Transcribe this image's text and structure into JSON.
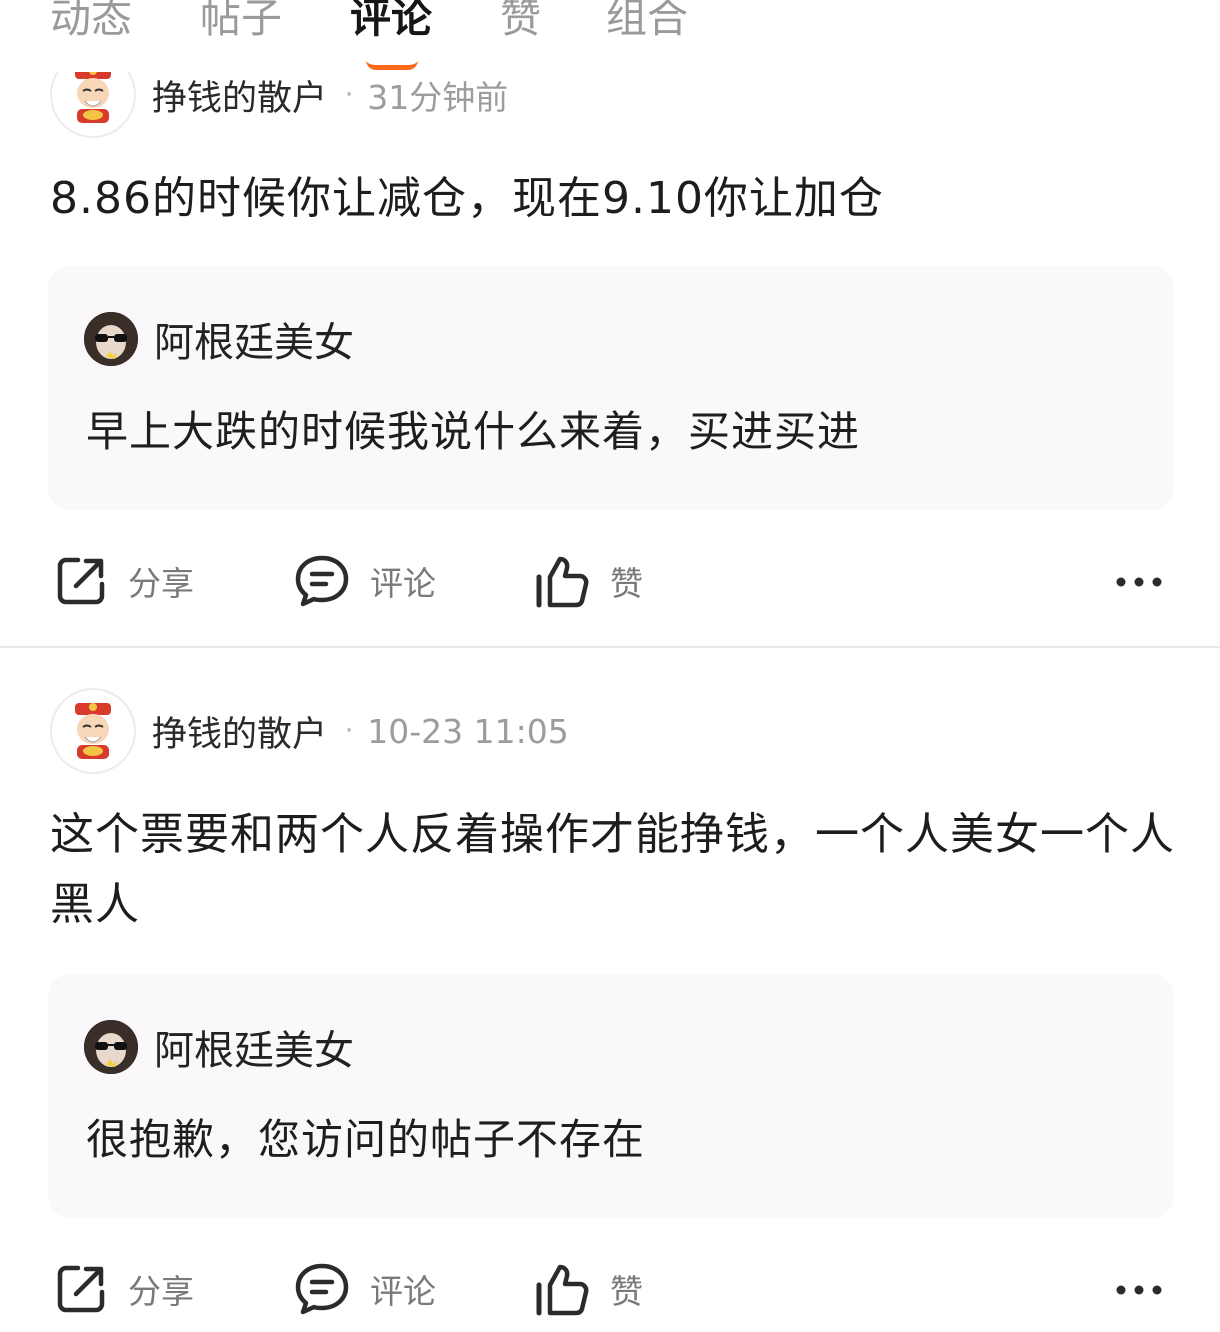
{
  "tabs": [
    {
      "label": "动态"
    },
    {
      "label": "帖子"
    },
    {
      "label": "评论"
    },
    {
      "label": "赞"
    },
    {
      "label": "组合"
    }
  ],
  "active_tab_index": 2,
  "colors": {
    "accent": "#ff6a1a",
    "quote_bg": "#fbf8fb",
    "muted_text": "#9c9c9c"
  },
  "comments": [
    {
      "author": "挣钱的散户",
      "time": "31分钟前",
      "text": "8.86的时候你让减仓，现在9.10你让加仓",
      "quote": {
        "author": "阿根廷美女",
        "text": "早上大跌的时候我说什么来着，买进买进"
      },
      "actions": {
        "share": "分享",
        "comment": "评论",
        "like": "赞"
      }
    },
    {
      "author": "挣钱的散户",
      "time": "10-23 11:05",
      "text": "这个票要和两个人反着操作才能挣钱，一个人美女一个人黑人",
      "quote": {
        "author": "阿根廷美女",
        "text": "很抱歉，您访问的帖子不存在"
      },
      "actions": {
        "share": "分享",
        "comment": "评论",
        "like": "赞"
      }
    }
  ],
  "icons": {
    "share": "share-icon",
    "comment": "comment-icon",
    "like": "thumbs-up-icon",
    "more": "more-icon",
    "avatar_author": "god-of-wealth-avatar",
    "avatar_quote": "sunglasses-avatar"
  }
}
